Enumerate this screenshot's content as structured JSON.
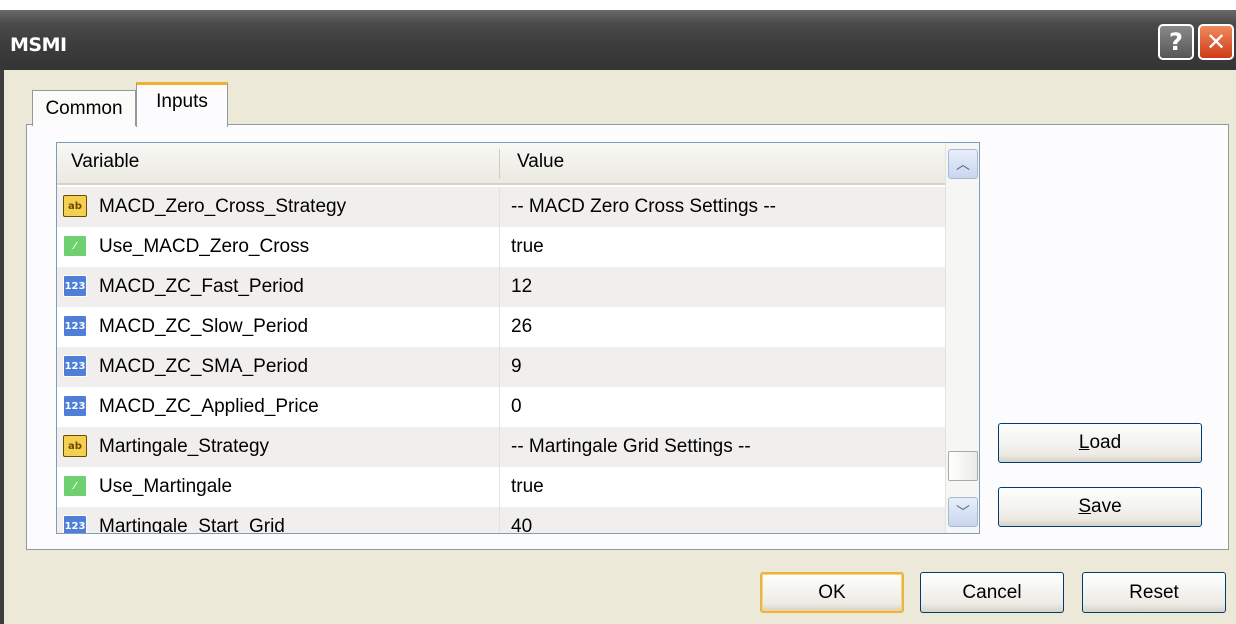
{
  "window": {
    "title": "MSMI"
  },
  "titlebar": {
    "help_glyph": "?",
    "close_glyph": "✕"
  },
  "tabs": [
    {
      "label": "Common"
    },
    {
      "label": "Inputs"
    }
  ],
  "table": {
    "columns": [
      "Variable",
      "Value"
    ],
    "rows": [
      {
        "icon": "ab",
        "variable": "MACD_Zero_Cross_Strategy",
        "value": "-- MACD Zero Cross Settings --"
      },
      {
        "icon": "bool",
        "variable": "Use_MACD_Zero_Cross",
        "value": "true"
      },
      {
        "icon": "num",
        "variable": "MACD_ZC_Fast_Period",
        "value": "12"
      },
      {
        "icon": "num",
        "variable": "MACD_ZC_Slow_Period",
        "value": "26"
      },
      {
        "icon": "num",
        "variable": "MACD_ZC_SMA_Period",
        "value": "9"
      },
      {
        "icon": "num",
        "variable": "MACD_ZC_Applied_Price",
        "value": "0"
      },
      {
        "icon": "ab",
        "variable": "Martingale_Strategy",
        "value": "-- Martingale Grid Settings --"
      },
      {
        "icon": "bool",
        "variable": "Use_Martingale",
        "value": "true"
      },
      {
        "icon": "num",
        "variable": "Martingale_Start_Grid",
        "value": "40"
      }
    ],
    "icon_labels": {
      "ab": "ab",
      "bool": "⁄",
      "num": "123"
    }
  },
  "buttons": {
    "load_first": "L",
    "load_rest": "oad",
    "save_first": "S",
    "save_rest": "ave",
    "ok": "OK",
    "cancel": "Cancel",
    "reset": "Reset"
  }
}
